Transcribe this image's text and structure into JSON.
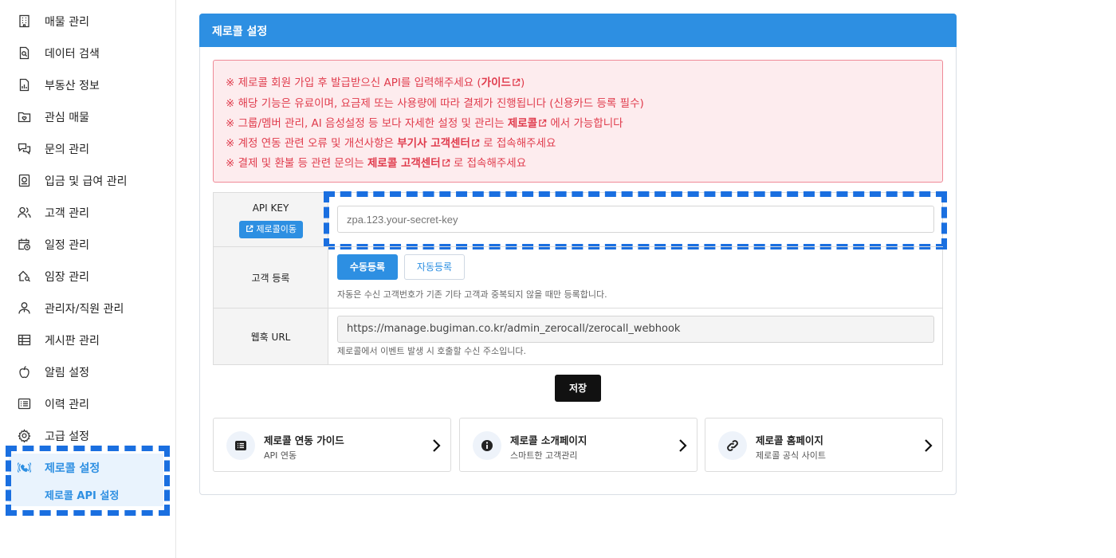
{
  "sidebar": {
    "items": [
      {
        "label": "매물 관리",
        "icon": "building-icon"
      },
      {
        "label": "데이터 검색",
        "icon": "document-search-icon"
      },
      {
        "label": "부동산 정보",
        "icon": "document-chart-icon"
      },
      {
        "label": "관심 매물",
        "icon": "folder-heart-icon"
      },
      {
        "label": "문의 관리",
        "icon": "chat-bubbles-icon"
      },
      {
        "label": "입금 및 급여 관리",
        "icon": "money-document-icon"
      },
      {
        "label": "고객 관리",
        "icon": "users-icon"
      },
      {
        "label": "일정 관리",
        "icon": "calendar-clock-icon"
      },
      {
        "label": "임장 관리",
        "icon": "house-search-icon"
      },
      {
        "label": "관리자/직원 관리",
        "icon": "staff-icon"
      },
      {
        "label": "게시판 관리",
        "icon": "table-icon"
      },
      {
        "label": "알림 설정",
        "icon": "apple-icon"
      },
      {
        "label": "이력 관리",
        "icon": "list-icon"
      },
      {
        "label": "고급 설정",
        "icon": "gear-icon"
      }
    ],
    "active": {
      "label": "제로콜 설정",
      "icon": "phone-signal-icon",
      "sub_label": "제로콜 API 설정"
    }
  },
  "panel": {
    "title": "제로콜 설정",
    "notice": {
      "line1_pre": "※ 제로콜 회원 가입 후 발급받으신 API를 입력해주세요 (",
      "line1_bold": "가이드",
      "line1_post": ")",
      "line2": "※ 해당 기능은 유료이며, 요금제 또는 사용량에 따라 결제가 진행됩니다 (신용카드 등록 필수)",
      "line3_pre": "※ 그룹/멤버 관리, AI 음성설정 등 보다 자세한 설정 및 관리는 ",
      "line3_bold": "제로콜",
      "line3_post": " 에서 가능합니다",
      "line4_pre": "※ 계정 연동 관련 오류 및 개선사항은 ",
      "line4_bold": "부기사 고객센터",
      "line4_post": " 로 접속해주세요",
      "line5_pre": "※ 결제 및 환불 등 관련 문의는 ",
      "line5_bold": "제로콜 고객센터",
      "line5_post": " 로 접속해주세요"
    },
    "api_key": {
      "label": "API KEY",
      "button": "제로콜이동",
      "placeholder": "zpa.123.your-secret-key"
    },
    "customer_reg": {
      "label": "고객 등록",
      "manual": "수동등록",
      "auto": "자동등록",
      "help": "자동은 수신 고객번호가 기존 기타 고객과 중복되지 않을 때만 등록합니다."
    },
    "webhook": {
      "label": "웹훅 URL",
      "value": "https://manage.bugiman.co.kr/admin_zerocall/zerocall_webhook",
      "help": "제로콜에서 이벤트 발생 시 호출할 수신 주소입니다."
    },
    "save": "저장"
  },
  "cards": [
    {
      "title": "제로콜 연동 가이드",
      "sub": "API 연동",
      "icon": "list-box-icon"
    },
    {
      "title": "제로콜 소개페이지",
      "sub": "스마트한 고객관리",
      "icon": "info-icon"
    },
    {
      "title": "제로콜 홈페이지",
      "sub": "제로콜 공식 사이트",
      "icon": "link-icon"
    }
  ],
  "colors": {
    "primary": "#2d8fe2",
    "alert_text": "#e03b4c",
    "alert_bg": "#fdecee",
    "highlight_dash": "#1a6fe0"
  }
}
